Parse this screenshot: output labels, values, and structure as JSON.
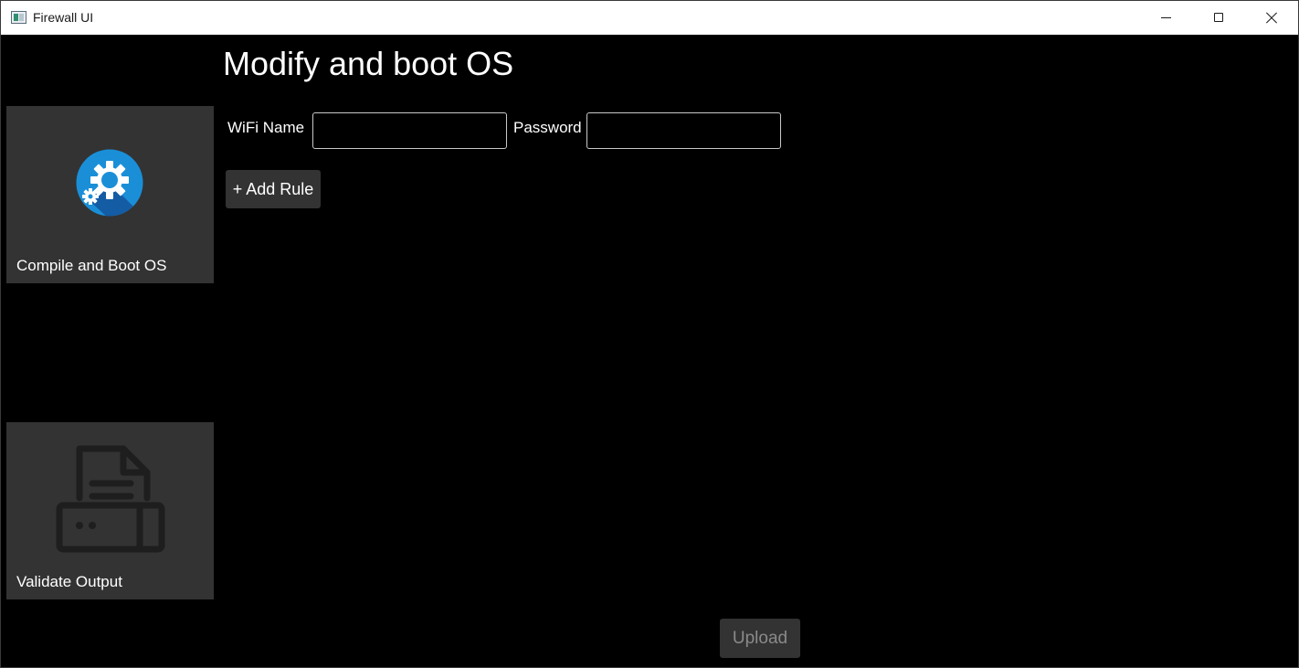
{
  "window": {
    "title": "Firewall UI"
  },
  "sidebar": {
    "items": [
      {
        "label": "Compile and Boot OS",
        "icon": "gear-icon"
      },
      {
        "label": "Validate Output",
        "icon": "printer-icon"
      }
    ]
  },
  "main": {
    "title": "Modify and boot OS",
    "wifi": {
      "label": "WiFi Name",
      "value": "",
      "placeholder": ""
    },
    "password": {
      "label": "Password",
      "value": "",
      "placeholder": ""
    },
    "add_rule_label": "+ Add Rule",
    "upload_label": "Upload"
  },
  "colors": {
    "background": "#000000",
    "tile": "#333333",
    "accent": "#1a8fd8",
    "upload_text": "#8a8a8a"
  }
}
